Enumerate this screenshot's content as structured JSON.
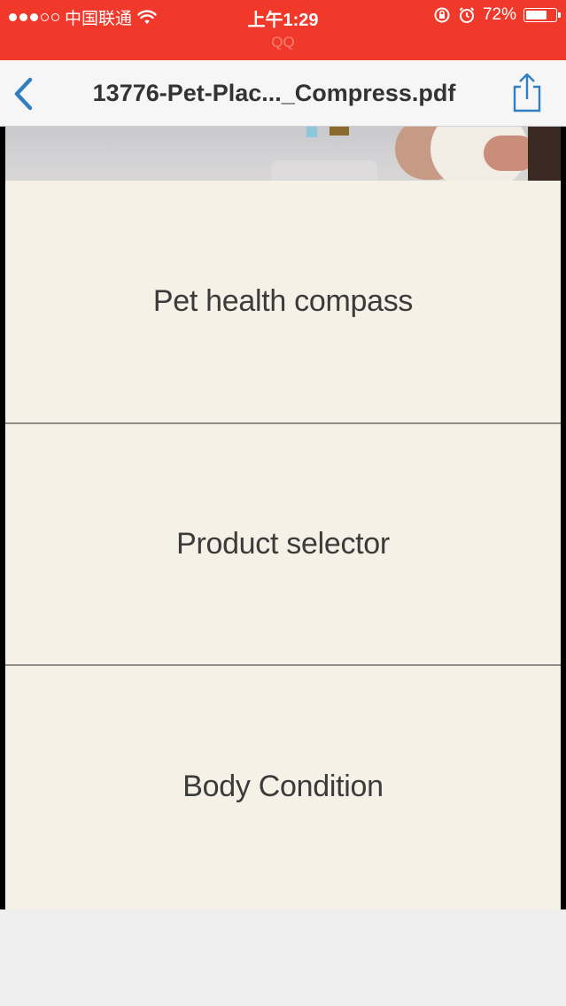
{
  "status_bar": {
    "carrier": "中国联通",
    "time": "上午1:29",
    "app_hint": "QQ",
    "battery_percent": "72%",
    "battery_level": 0.72,
    "signal_bars_filled": 3,
    "signal_bars_total": 5,
    "background_color": "#f0392b"
  },
  "nav_bar": {
    "title": "13776-Pet-Plac..._Compress.pdf",
    "back_icon": "chevron-left-icon",
    "share_icon": "share-icon",
    "accent_color": "#2f7fc1"
  },
  "document": {
    "items": [
      {
        "label": "Pet health compass"
      },
      {
        "label": "Product selector"
      },
      {
        "label": "Body Condition"
      }
    ],
    "page_color": "#f6f1e6"
  }
}
